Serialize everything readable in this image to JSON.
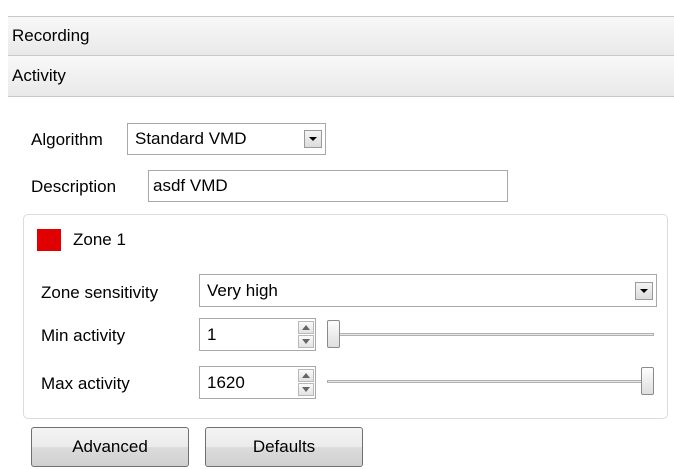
{
  "sections": {
    "recording": "Recording",
    "activity": "Activity"
  },
  "algorithm": {
    "label": "Algorithm",
    "value": "Standard VMD"
  },
  "description": {
    "label": "Description",
    "value": "asdf VMD"
  },
  "zone": {
    "name": "Zone 1",
    "color": "#e00000",
    "sensitivity_label": "Zone sensitivity",
    "sensitivity_value": "Very high",
    "min_label": "Min activity",
    "min_value": "1",
    "min_slider_fraction": 0.0,
    "max_label": "Max activity",
    "max_value": "1620",
    "max_slider_fraction": 1.0
  },
  "buttons": {
    "advanced": "Advanced",
    "defaults": "Defaults"
  },
  "icons": {
    "dropdown": "chevron-down-icon",
    "spin_up": "spin-up-icon",
    "spin_down": "spin-down-icon"
  }
}
